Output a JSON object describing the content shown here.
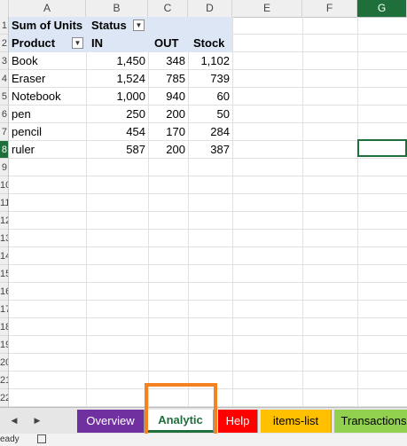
{
  "columns": [
    "A",
    "B",
    "C",
    "D",
    "E",
    "F",
    "G"
  ],
  "rows": [
    "1",
    "2",
    "3",
    "4",
    "5",
    "6",
    "7",
    "8",
    "9",
    "10",
    "11",
    "12",
    "13",
    "14",
    "15",
    "16",
    "17",
    "18",
    "19",
    "20",
    "21",
    "22"
  ],
  "pivot": {
    "values_label": "Sum of Units",
    "columns_field": "Status",
    "rows_field": "Product",
    "headers": [
      "IN",
      "OUT",
      "Stock"
    ],
    "rows": [
      {
        "product": "Book",
        "in": "1,450",
        "out": "348",
        "stock": "1,102"
      },
      {
        "product": "Eraser",
        "in": "1,524",
        "out": "785",
        "stock": "739"
      },
      {
        "product": "Notebook",
        "in": "1,000",
        "out": "940",
        "stock": "60"
      },
      {
        "product": "pen",
        "in": "250",
        "out": "200",
        "stock": "50"
      },
      {
        "product": "pencil",
        "in": "454",
        "out": "170",
        "stock": "284"
      },
      {
        "product": "ruler",
        "in": "587",
        "out": "200",
        "stock": "387"
      }
    ]
  },
  "tabs": [
    {
      "label": "Overview",
      "color": "#7030a0",
      "text_color": "#ffffff"
    },
    {
      "label": "Analytic",
      "color": "#ffffff",
      "text_color": "#1f6f3a"
    },
    {
      "label": "Help",
      "color": "#ff0000",
      "text_color": "#ffffff"
    },
    {
      "label": "items-list",
      "color": "#ffc000",
      "text_color": "#000000"
    },
    {
      "label": "Transactions",
      "color": "#92d050",
      "text_color": "#000000"
    }
  ],
  "nav": {
    "prev_icon": "chevron-left-icon",
    "next_icon": "chevron-right-icon"
  },
  "status": {
    "text": "eady",
    "icon": "accessibility-icon"
  },
  "colors": {
    "accent": "#1f6f3a",
    "highlight": "#f58220",
    "pivot_header": "#dce6f4"
  }
}
